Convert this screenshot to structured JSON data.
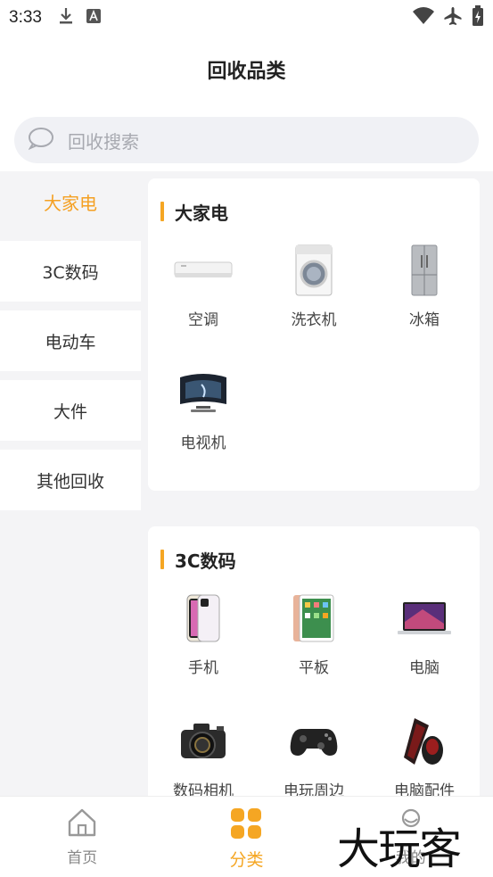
{
  "status": {
    "time": "3:33"
  },
  "header": {
    "title": "回收品类"
  },
  "search": {
    "placeholder": "回收搜索"
  },
  "sidebar": {
    "items": [
      {
        "label": "大家电",
        "active": true
      },
      {
        "label": "3C数码",
        "active": false
      },
      {
        "label": "电动车",
        "active": false
      },
      {
        "label": "大件",
        "active": false
      },
      {
        "label": "其他回收",
        "active": false
      }
    ]
  },
  "sections": [
    {
      "title": "大家电",
      "items": [
        {
          "label": "空调",
          "icon": "air-conditioner-icon"
        },
        {
          "label": "洗衣机",
          "icon": "washing-machine-icon"
        },
        {
          "label": "冰箱",
          "icon": "refrigerator-icon"
        },
        {
          "label": "电视机",
          "icon": "television-icon"
        }
      ]
    },
    {
      "title": "3C数码",
      "items": [
        {
          "label": "手机",
          "icon": "phone-icon"
        },
        {
          "label": "平板",
          "icon": "tablet-icon"
        },
        {
          "label": "电脑",
          "icon": "laptop-icon"
        },
        {
          "label": "数码相机",
          "icon": "camera-icon"
        },
        {
          "label": "电玩周边",
          "icon": "gamepad-icon"
        },
        {
          "label": "电脑配件",
          "icon": "keyboard-mouse-icon"
        }
      ]
    }
  ],
  "tabbar": {
    "items": [
      {
        "label": "首页",
        "icon": "home-icon",
        "active": false
      },
      {
        "label": "分类",
        "icon": "category-icon",
        "active": true
      },
      {
        "label": "我的",
        "icon": "profile-icon",
        "active": false
      }
    ]
  },
  "watermark": "大玩客",
  "colors": {
    "accent": "#f5a623",
    "background": "#f4f4f6",
    "text": "#333333"
  }
}
